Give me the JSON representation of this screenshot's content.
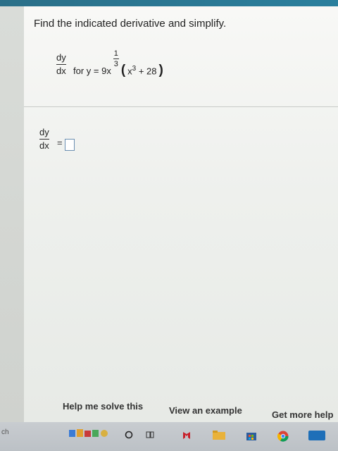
{
  "problem": {
    "instruction": "Find the indicated derivative and simplify.",
    "deriv_num": "dy",
    "deriv_den": "dx",
    "for_text": "for y = 9x",
    "exp_num": "1",
    "exp_den": "3",
    "paren_open": "(",
    "paren_close": ")",
    "inner_base": "x",
    "inner_exp": "3",
    "inner_rest": " + 28"
  },
  "answer": {
    "deriv_num": "dy",
    "deriv_den": "dx",
    "equals": "=",
    "value": ""
  },
  "actions": {
    "help": "Help me solve this",
    "example": "View an example",
    "more": "Get more help"
  },
  "taskbar": {
    "search_text": "ch"
  },
  "colors": {
    "topbar": "#2a7f9d",
    "answer_border": "#6b8fb1"
  }
}
